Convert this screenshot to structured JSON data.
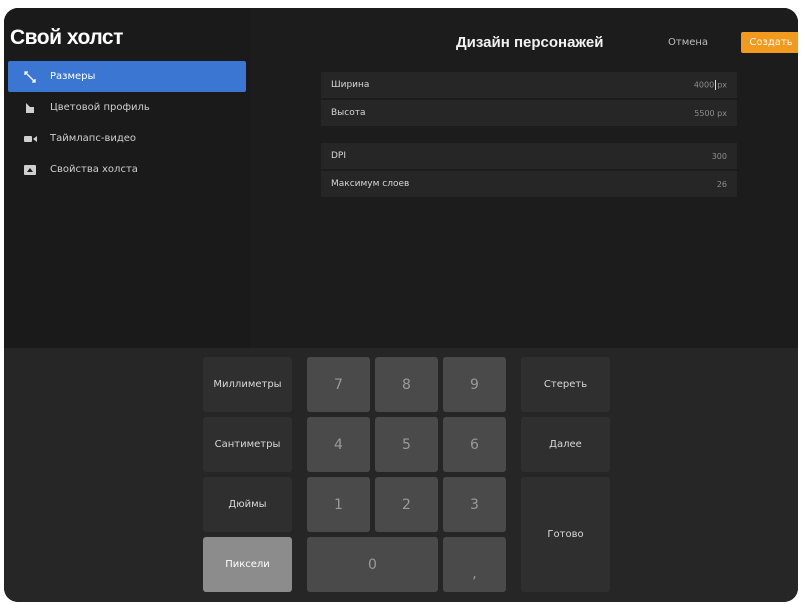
{
  "sidebar": {
    "title": "Свой холст",
    "items": [
      {
        "label": "Размеры",
        "icon": "resize-icon",
        "active": true
      },
      {
        "label": "Цветовой профиль",
        "icon": "color-profile-icon",
        "active": false
      },
      {
        "label": "Таймлапс-видео",
        "icon": "video-camera-icon",
        "active": false
      },
      {
        "label": "Свойства холста",
        "icon": "canvas-properties-icon",
        "active": false
      }
    ]
  },
  "header": {
    "title": "Дизайн персонажей",
    "cancel_label": "Отмена",
    "create_label": "Создать"
  },
  "fields": {
    "width": {
      "label": "Ширина",
      "value": "4000",
      "unit": "px"
    },
    "height": {
      "label": "Высота",
      "value": "5500 px"
    },
    "dpi": {
      "label": "DPI",
      "value": "300"
    },
    "max_layers": {
      "label": "Максимум слоев",
      "value": "26"
    }
  },
  "keyboard": {
    "units": {
      "mm": "Миллиметры",
      "cm": "Сантиметры",
      "inch": "Дюймы",
      "px": "Пиксели"
    },
    "selected_unit": "px",
    "digits": {
      "d0": "0",
      "d1": "1",
      "d2": "2",
      "d3": "3",
      "d4": "4",
      "d5": "5",
      "d6": "6",
      "d7": "7",
      "d8": "8",
      "d9": "9"
    },
    "comma": ",",
    "erase": "Стереть",
    "next": "Далее",
    "done": "Готово"
  },
  "colors": {
    "accent_blue": "#3a76d2",
    "accent_orange": "#f19a1e",
    "background": "#1c1c1c"
  }
}
